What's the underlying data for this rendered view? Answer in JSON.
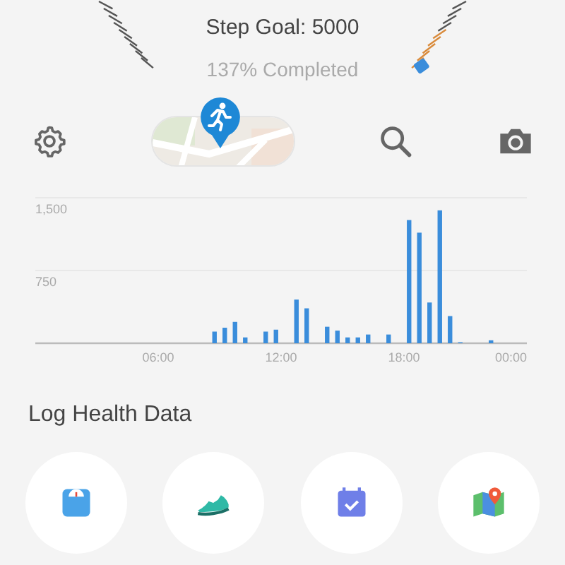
{
  "goal": {
    "title": "Step Goal: 5000",
    "progress_text": "137% Completed"
  },
  "toolbar": [
    {
      "kind": "settings"
    },
    {
      "kind": "map"
    },
    {
      "kind": "search"
    },
    {
      "kind": "camera"
    }
  ],
  "steps_chart": {
    "chart_data": {
      "type": "bar",
      "x": [
        8.75,
        9.25,
        9.75,
        10.25,
        11.25,
        11.75,
        12.75,
        13.25,
        14.25,
        14.75,
        15.25,
        15.75,
        16.25,
        17.25,
        18.25,
        18.75,
        19.25,
        19.75,
        20.25,
        20.75,
        22.25
      ],
      "values": [
        120,
        160,
        220,
        60,
        120,
        140,
        450,
        360,
        170,
        130,
        60,
        60,
        90,
        90,
        1270,
        1140,
        420,
        1370,
        280,
        10,
        30
      ],
      "xlim": [
        0,
        24
      ],
      "ylim": [
        0,
        1500
      ],
      "xticks": [
        {
          "value": 6,
          "label": "06:00"
        },
        {
          "value": 12,
          "label": "12:00"
        },
        {
          "value": 18,
          "label": "18:00"
        },
        {
          "value": 24,
          "label": "00:00"
        }
      ],
      "yticks": [
        {
          "value": 750,
          "label": "750"
        },
        {
          "value": 1500,
          "label": "1,500"
        }
      ]
    }
  },
  "log_section": {
    "title": "Log Health Data",
    "actions": [
      {
        "kind": "weight"
      },
      {
        "kind": "exercise"
      },
      {
        "kind": "calendar"
      },
      {
        "kind": "location"
      }
    ]
  }
}
